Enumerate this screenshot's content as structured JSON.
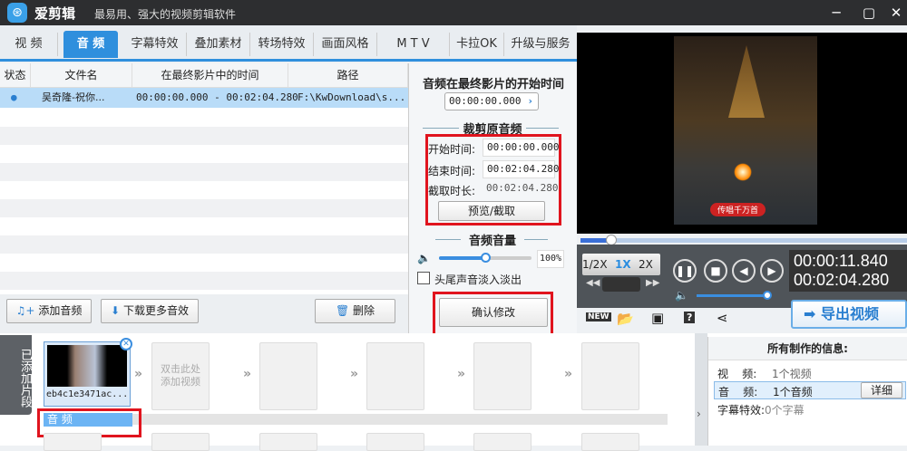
{
  "app": {
    "name": "爱剪辑",
    "slogan": "最易用、强大的视频剪辑软件"
  },
  "tabs": [
    {
      "label": "视 频"
    },
    {
      "label": "音 频"
    },
    {
      "label": "字幕特效"
    },
    {
      "label": "叠加素材"
    },
    {
      "label": "转场特效"
    },
    {
      "label": "画面风格"
    },
    {
      "label": "M T V"
    },
    {
      "label": "卡拉OK"
    },
    {
      "label": "升级与服务"
    }
  ],
  "table": {
    "headers": [
      "状态",
      "文件名",
      "在最终影片中的时间",
      "路径"
    ],
    "rows": [
      {
        "status": "●",
        "name": "吴奇隆-祝你...",
        "time": "00:00:00.000 - 00:02:04.280",
        "path": "F:\\KwDownload\\s..."
      }
    ]
  },
  "buttons": {
    "add_audio": "添加音频",
    "download": "下载更多音效",
    "delete": "删除",
    "confirm": "确认修改",
    "preview": "预览/截取",
    "export": "导出视频",
    "detail": "详细"
  },
  "audio_panel": {
    "start_title": "音频在最终影片的开始时间",
    "start_value": "00:00:00.000",
    "crop_title": "裁剪原音频",
    "start_label": "开始时间:",
    "start": "00:00:00.000",
    "end_label": "结束时间:",
    "end": "00:02:04.280",
    "dur_label": "截取时长:",
    "dur": "00:02:04.280",
    "volume_title": "音频音量",
    "volume": "100%",
    "fade_label": "头尾声音淡入淡出"
  },
  "player": {
    "speeds": [
      "1/2X",
      "1X",
      "2X"
    ],
    "current": "00:00:11.840",
    "total": "00:02:04.280",
    "progress": 0.095,
    "caption": "传唱千万首"
  },
  "timeline": {
    "side_label": "已添加片段",
    "clip_name": "eb4c1e3471ac...",
    "add_hint": "双击此处添加视频",
    "audio_track": "音 频"
  },
  "info": {
    "title": "所有制作的信息:",
    "items": [
      {
        "k": "视    频:",
        "v": "1个视频"
      },
      {
        "k": "音    频:",
        "v": "1个音频"
      },
      {
        "k": "字幕特效:",
        "v": "0个字幕"
      }
    ]
  }
}
